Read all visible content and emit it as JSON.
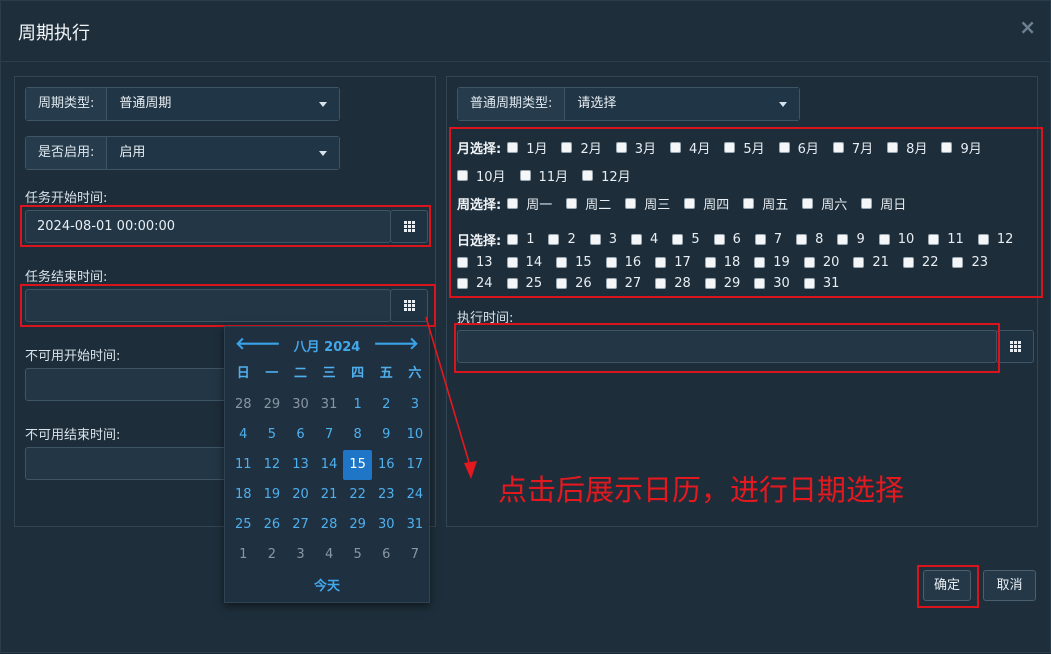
{
  "dialog": {
    "title": "周期执行",
    "close": "×"
  },
  "left": {
    "cycle_type": {
      "label": "周期类型:",
      "value": "普通周期"
    },
    "enabled": {
      "label": "是否启用:",
      "value": "启用"
    },
    "task_start": {
      "label": "任务开始时间:",
      "value": "2024-08-01 00:00:00"
    },
    "task_end": {
      "label": "任务结束时间:",
      "value": ""
    },
    "unavail_start": {
      "label": "不可用开始时间:"
    },
    "unavail_end": {
      "label": "不可用结束时间:"
    }
  },
  "calendar": {
    "prev": "🡐",
    "next": "🡒",
    "month": "八月 2024",
    "weekdays": [
      "日",
      "一",
      "二",
      "三",
      "四",
      "五",
      "六"
    ],
    "days": [
      {
        "d": "28",
        "m": true
      },
      {
        "d": "29",
        "m": true
      },
      {
        "d": "30",
        "m": true
      },
      {
        "d": "31",
        "m": true
      },
      {
        "d": "1"
      },
      {
        "d": "2"
      },
      {
        "d": "3"
      },
      {
        "d": "4"
      },
      {
        "d": "5"
      },
      {
        "d": "6"
      },
      {
        "d": "7"
      },
      {
        "d": "8"
      },
      {
        "d": "9"
      },
      {
        "d": "10"
      },
      {
        "d": "11"
      },
      {
        "d": "12"
      },
      {
        "d": "13"
      },
      {
        "d": "14"
      },
      {
        "d": "15",
        "s": true
      },
      {
        "d": "16"
      },
      {
        "d": "17"
      },
      {
        "d": "18"
      },
      {
        "d": "19"
      },
      {
        "d": "20"
      },
      {
        "d": "21"
      },
      {
        "d": "22"
      },
      {
        "d": "23"
      },
      {
        "d": "24"
      },
      {
        "d": "25"
      },
      {
        "d": "26"
      },
      {
        "d": "27"
      },
      {
        "d": "28"
      },
      {
        "d": "29"
      },
      {
        "d": "30"
      },
      {
        "d": "31"
      },
      {
        "d": "1",
        "m": true
      },
      {
        "d": "2",
        "m": true
      },
      {
        "d": "3",
        "m": true
      },
      {
        "d": "4",
        "m": true
      },
      {
        "d": "5",
        "m": true
      },
      {
        "d": "6",
        "m": true
      },
      {
        "d": "7",
        "m": true
      }
    ],
    "today": "今天"
  },
  "right": {
    "normal_cycle_type": {
      "label": "普通周期类型:",
      "value": "请选择"
    },
    "month_select": {
      "label": "月选择:",
      "options": [
        "1月",
        "2月",
        "3月",
        "4月",
        "5月",
        "6月",
        "7月",
        "8月",
        "9月",
        "10月",
        "11月",
        "12月"
      ]
    },
    "week_select": {
      "label": "周选择:",
      "options": [
        "周一",
        "周二",
        "周三",
        "周四",
        "周五",
        "周六",
        "周日"
      ]
    },
    "day_select": {
      "label": "日选择:",
      "options": [
        "1",
        "2",
        "3",
        "4",
        "5",
        "6",
        "7",
        "8",
        "9",
        "10",
        "11",
        "12",
        "13",
        "14",
        "15",
        "16",
        "17",
        "18",
        "19",
        "20",
        "21",
        "22",
        "23",
        "24",
        "25",
        "26",
        "27",
        "28",
        "29",
        "30",
        "31"
      ]
    },
    "exec_time": {
      "label": "执行时间:",
      "value": ""
    }
  },
  "annotation": "点击后展示日历，进行日期选择",
  "buttons": {
    "confirm": "确定",
    "cancel": "取消"
  },
  "colors": {
    "accent": "#42a8ea",
    "highlight": "#d9141c",
    "selected_day": "#1f76c7"
  }
}
